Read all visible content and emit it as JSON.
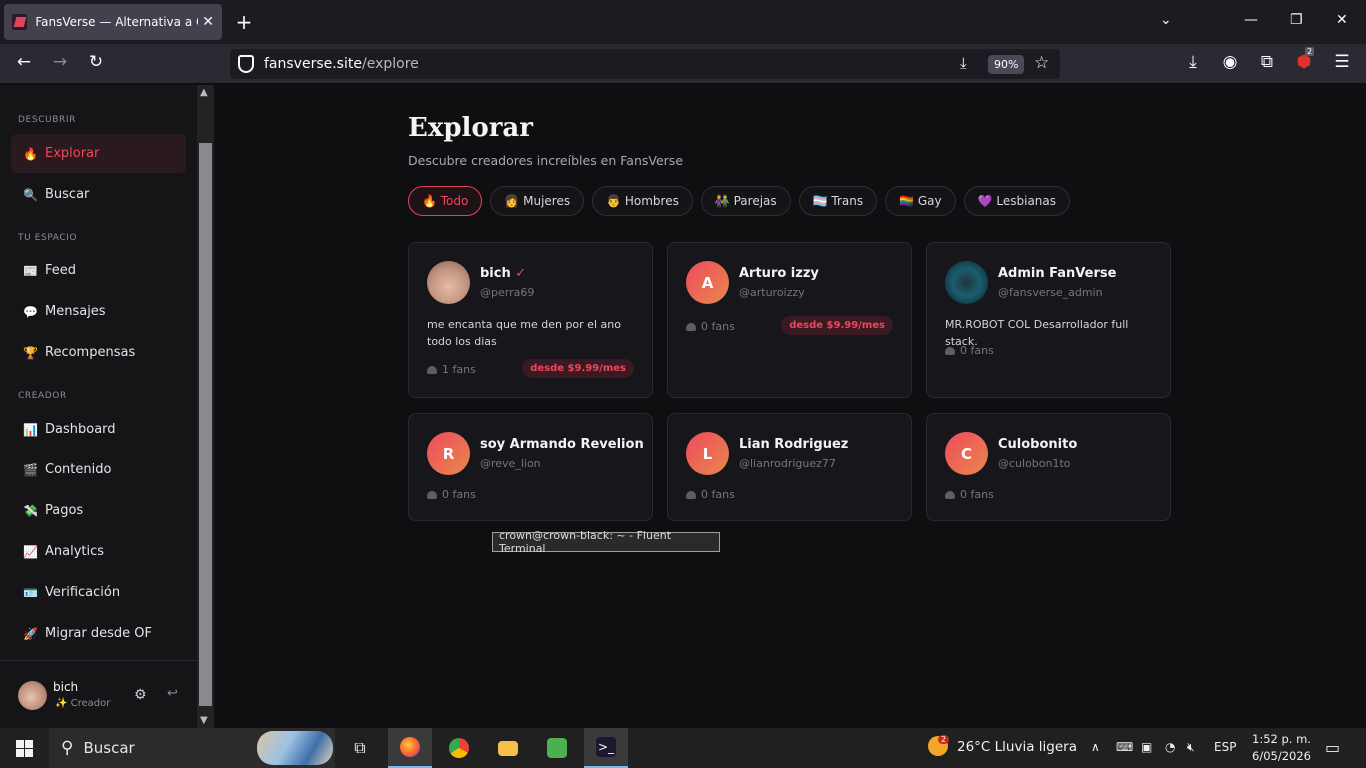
{
  "browser": {
    "tab_title": "FansVerse — Alternativa a OnlyFans",
    "url_domain": "fansverse.site",
    "url_path": "/explore",
    "zoom": "90%",
    "ext_badge": "2"
  },
  "sidebar": {
    "sections": {
      "discover": "DESCUBRIR",
      "your_space": "TU ESPACIO",
      "creator": "CREADOR"
    },
    "items": [
      {
        "icon": "🔥",
        "label": "Explorar"
      },
      {
        "icon": "🔍",
        "label": "Buscar"
      },
      {
        "icon": "📰",
        "label": "Feed"
      },
      {
        "icon": "💬",
        "label": "Mensajes"
      },
      {
        "icon": "🏆",
        "label": "Recompensas"
      },
      {
        "icon": "📊",
        "label": "Dashboard"
      },
      {
        "icon": "🎬",
        "label": "Contenido"
      },
      {
        "icon": "💸",
        "label": "Pagos"
      },
      {
        "icon": "📈",
        "label": "Analytics"
      },
      {
        "icon": "🪪",
        "label": "Verificación"
      },
      {
        "icon": "🚀",
        "label": "Migrar desde OF"
      }
    ],
    "user": {
      "name": "bich",
      "role": "✨ Creador"
    }
  },
  "page": {
    "title": "Explorar",
    "subtitle": "Descubre creadores increíbles en FansVerse",
    "filters": [
      "🔥 Todo",
      "👩 Mujeres",
      "👨 Hombres",
      "👫 Parejas",
      "🏳️‍⚧️ Trans",
      "🏳️‍🌈 Gay",
      "💜 Lesbianas"
    ]
  },
  "creators": [
    {
      "initial": "",
      "name": "bich",
      "verified": "✓",
      "handle": "@perra69",
      "bio": "me encanta que me den por el ano todo los dias",
      "fans": "1 fans",
      "price": "desde $9.99/mes"
    },
    {
      "initial": "A",
      "name": "Arturo izzy",
      "verified": "",
      "handle": "@arturoizzy",
      "bio": "",
      "fans": "0 fans",
      "price": "desde $9.99/mes"
    },
    {
      "initial": "",
      "name": "Admin FanVerse",
      "verified": "",
      "handle": "@fansverse_admin",
      "bio": "MR.ROBOT COL Desarrollador full stack.",
      "fans": "0 fans",
      "price": ""
    },
    {
      "initial": "R",
      "name": "soy Armando Revelion",
      "verified": "",
      "handle": "@reve_lion",
      "bio": "",
      "fans": "0 fans",
      "price": ""
    },
    {
      "initial": "L",
      "name": "Lian Rodriguez",
      "verified": "",
      "handle": "@lianrodriguez77",
      "bio": "",
      "fans": "0 fans",
      "price": ""
    },
    {
      "initial": "C",
      "name": "Culobonito",
      "verified": "",
      "handle": "@culobon1to",
      "bio": "",
      "fans": "0 fans",
      "price": ""
    }
  ],
  "tooltip": "crown@crown-black: ~ - Fluent Terminal",
  "taskbar": {
    "search": "Buscar",
    "weather": "26°C  Lluvia ligera",
    "weather_badge": "2",
    "lang": "ESP",
    "time": "1:52 p. m.",
    "date": "6/05/2026"
  }
}
